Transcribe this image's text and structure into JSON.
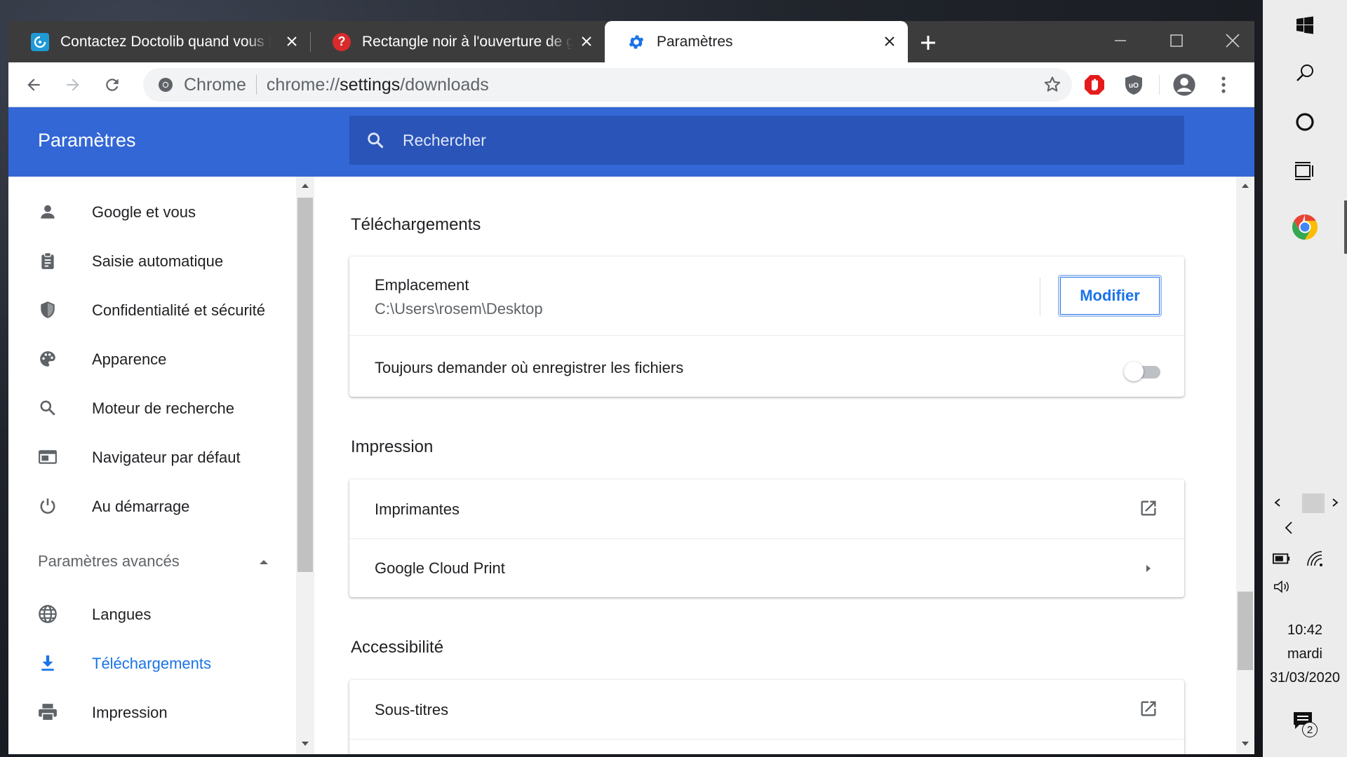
{
  "browser": {
    "tabs": [
      {
        "title": "Contactez Doctolib quand vous le",
        "favicon": "doctolib-icon",
        "active": false
      },
      {
        "title": "Rectangle noir à l'ouverture de g",
        "favicon": "question-icon",
        "active": false
      },
      {
        "title": "Paramètres",
        "favicon": "settings-gear-icon",
        "active": true
      }
    ],
    "omnibox": {
      "site_label": "Chrome",
      "url_prefix": "chrome://",
      "url_host": "settings",
      "url_path": "/downloads"
    }
  },
  "settings": {
    "header_title": "Paramètres",
    "search_placeholder": "Rechercher",
    "nav": [
      {
        "label": "Google et vous",
        "icon": "person-icon"
      },
      {
        "label": "Saisie automatique",
        "icon": "clipboard-icon"
      },
      {
        "label": "Confidentialité et sécurité",
        "icon": "shield-icon"
      },
      {
        "label": "Apparence",
        "icon": "palette-icon"
      },
      {
        "label": "Moteur de recherche",
        "icon": "search-icon"
      },
      {
        "label": "Navigateur par défaut",
        "icon": "browser-icon"
      },
      {
        "label": "Au démarrage",
        "icon": "power-icon"
      }
    ],
    "advanced_header": "Paramètres avancés",
    "advanced_nav": [
      {
        "label": "Langues",
        "icon": "globe-icon"
      },
      {
        "label": "Téléchargements",
        "icon": "download-icon",
        "active": true
      },
      {
        "label": "Impression",
        "icon": "printer-icon"
      }
    ],
    "downloads": {
      "title": "Téléchargements",
      "location_label": "Emplacement",
      "location_value": "C:\\Users\\rosem\\Desktop",
      "modify_button": "Modifier",
      "ask_label": "Toujours demander où enregistrer les fichiers",
      "ask_enabled": false
    },
    "printing": {
      "title": "Impression",
      "printers_label": "Imprimantes",
      "cloud_print_label": "Google Cloud Print"
    },
    "accessibility": {
      "title": "Accessibilité",
      "captions_label": "Sous-titres"
    }
  },
  "taskbar": {
    "time": "10:42",
    "day": "mardi",
    "date": "31/03/2020",
    "notification_count": "2"
  },
  "colors": {
    "accent_blue": "#3367d6",
    "link_blue": "#1a73e8",
    "tab_strip": "#3c3c3c"
  }
}
